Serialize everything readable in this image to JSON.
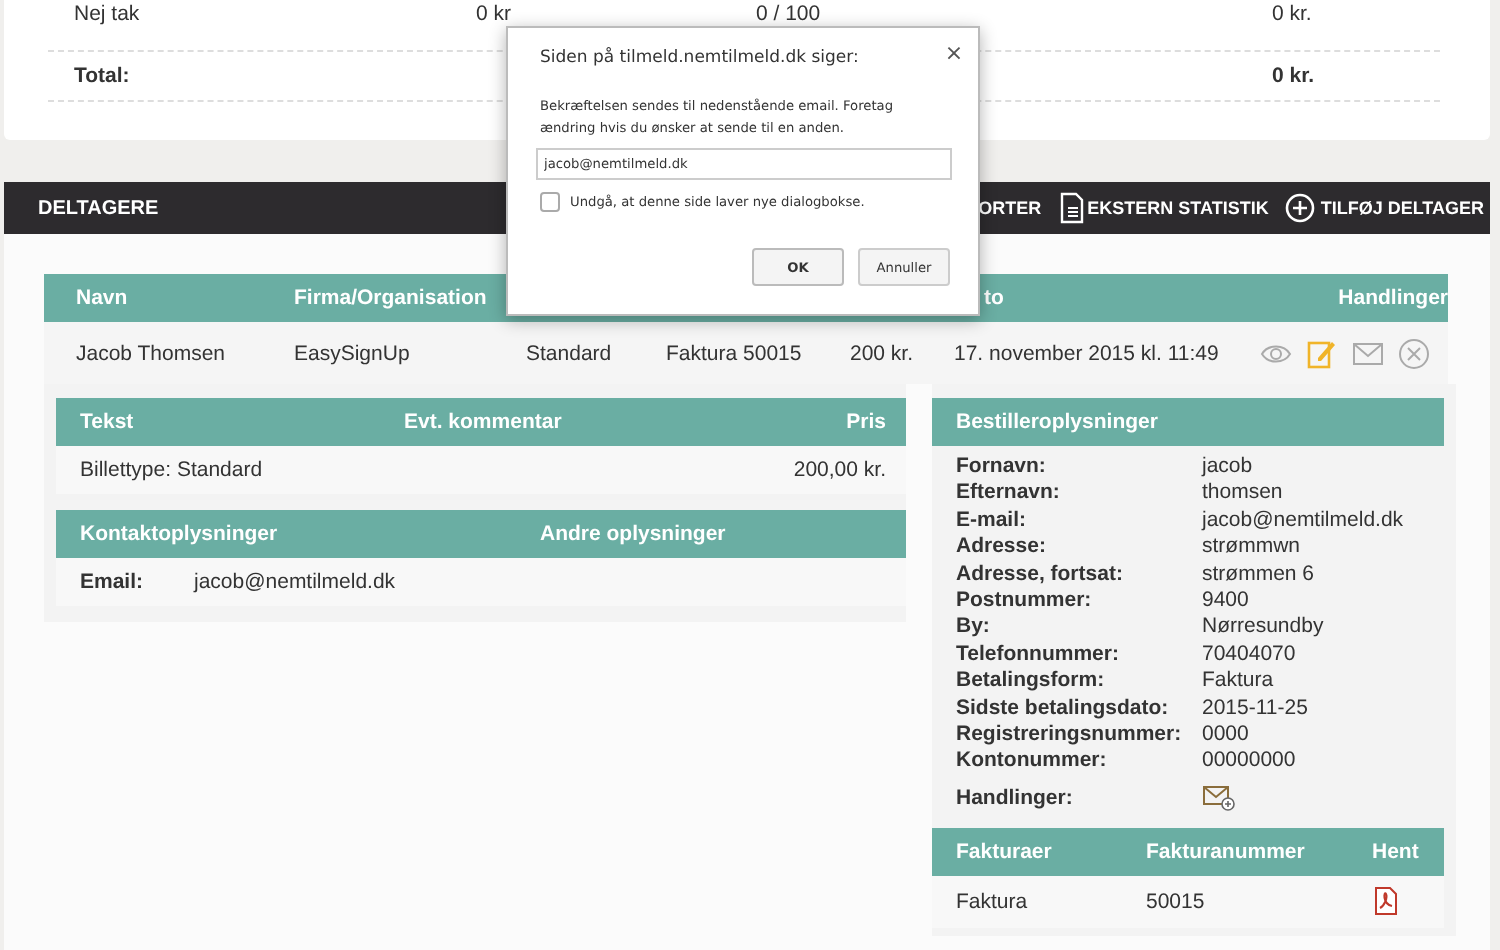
{
  "summary": {
    "rows": [
      {
        "label": "Nej tak",
        "amount": "0 kr",
        "count": "0 / 100",
        "total": "0 kr."
      }
    ],
    "total": {
      "label": "Total:",
      "value": "0 kr."
    }
  },
  "toolbar": {
    "title": "DELTAGERE",
    "actions": [
      {
        "label": "ORTER"
      },
      {
        "label": "EKSTERN STATISTIK"
      },
      {
        "label": "TILFØJ DELTAGER"
      }
    ]
  },
  "participants": {
    "columns": [
      "Navn",
      "Firma/Organisation",
      "",
      "",
      "",
      "to",
      "Handlinger"
    ],
    "rows": [
      {
        "cells": [
          "Jacob Thomsen",
          "EasySignUp",
          "Standard",
          "Faktura 50015",
          "200 kr.",
          "17. november 2015 kl. 11:49"
        ],
        "actions": [
          {
            "kind": "view"
          },
          {
            "kind": "edit"
          },
          {
            "kind": "mail"
          },
          {
            "kind": "delete"
          }
        ]
      }
    ]
  },
  "order_lines": {
    "columns": [
      "Tekst",
      "Evt. kommentar",
      "Pris"
    ],
    "rows": [
      {
        "text": "Billettype: Standard",
        "comment": "",
        "price": "200,00 kr."
      }
    ]
  },
  "contact": {
    "columns": [
      "Kontaktoplysninger",
      "Andre oplysninger"
    ],
    "fields": [
      {
        "label": "Email:",
        "value": "jacob@nemtilmeld.dk"
      }
    ]
  },
  "orderer": {
    "title": "Bestilleroplysninger",
    "fields": [
      {
        "label": "Fornavn:",
        "value": "jacob"
      },
      {
        "label": "Efternavn:",
        "value": "thomsen"
      },
      {
        "label": "E-mail:",
        "value": "jacob@nemtilmeld.dk"
      },
      {
        "label": "Adresse:",
        "value": "strømmwn"
      },
      {
        "label": "Adresse, fortsat:",
        "value": "strømmen 6"
      },
      {
        "label": "Postnummer:",
        "value": "9400"
      },
      {
        "label": "By:",
        "value": "Nørresundby"
      },
      {
        "label": "Telefonnummer:",
        "value": "70404070"
      },
      {
        "label": "Betalingsform:",
        "value": "Faktura"
      },
      {
        "label": "Sidste betalingsdato:",
        "value": "2015-11-25"
      },
      {
        "label": "Registreringsnummer:",
        "value": "0000"
      },
      {
        "label": "Kontonummer:",
        "value": "00000000"
      }
    ],
    "actions_label": "Handlinger:"
  },
  "invoices": {
    "columns": [
      "Fakturaer",
      "Fakturanummer",
      "Hent"
    ],
    "rows": [
      {
        "name": "Faktura",
        "number": "50015"
      }
    ]
  },
  "dialog": {
    "title": "Siden på tilmeld.nemtilmeld.dk siger:",
    "close": "×",
    "message": "Bekræftelsen sendes til nedenstående email. Foretag ændring hvis du ønsker at sende til en anden.",
    "input_value": "jacob@nemtilmeld.dk",
    "checkbox": {
      "label": "Undgå, at denne side laver nye dialogbokse.",
      "checked": false
    },
    "buttons": [
      {
        "label": "OK",
        "default": true
      },
      {
        "label": "Annuller",
        "default": false
      }
    ]
  }
}
